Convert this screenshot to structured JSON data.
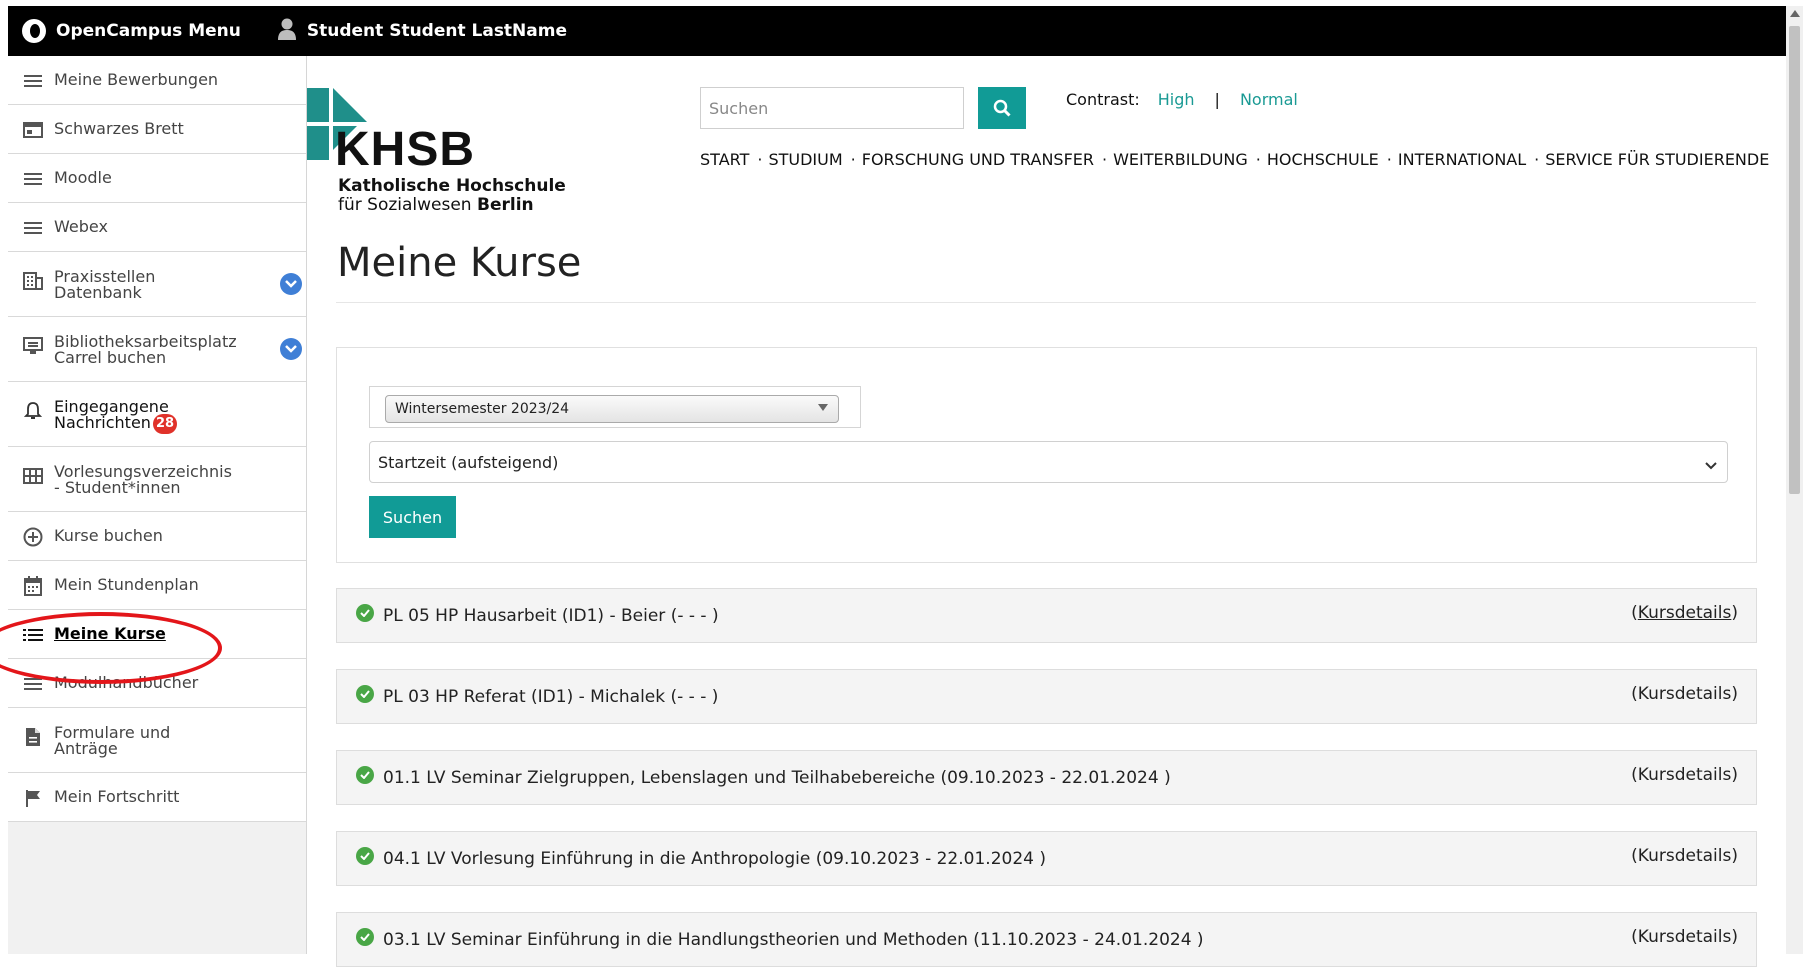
{
  "topbar": {
    "menu_label": "OpenCampus Menu",
    "user_name": "Student Student LastName"
  },
  "sidebar": {
    "items": [
      {
        "label": "Meine Bewerbungen",
        "icon": "hamburger-icon"
      },
      {
        "label": "Schwarzes Brett",
        "icon": "board-icon"
      },
      {
        "label": "Moodle",
        "icon": "hamburger-icon"
      },
      {
        "label": "Webex",
        "icon": "hamburger-icon"
      },
      {
        "label_1": "Praxisstellen",
        "label_2": "Datenbank",
        "icon": "building-icon",
        "has_dropdown": true
      },
      {
        "label_1": "Bibliotheksarbeitsplatz",
        "label_2": "Carrel buchen",
        "icon": "monitor-icon",
        "has_dropdown": true
      },
      {
        "label_1": "Eingegangene",
        "label_2": "Nachrichten",
        "icon": "bell-icon",
        "badge": "28"
      },
      {
        "label_1": "Vorlesungsverzeichnis",
        "label_2": "- Student*innen",
        "icon": "grid-icon"
      },
      {
        "label": "Kurse buchen",
        "icon": "plus-circle-icon"
      },
      {
        "label": "Mein Stundenplan",
        "icon": "calendar-icon"
      },
      {
        "label": "Meine Kurse",
        "icon": "list-icon",
        "active": true
      },
      {
        "label": "Modulhandbücher",
        "icon": "hamburger-icon"
      },
      {
        "label_1": "Formulare und",
        "label_2": "Anträge",
        "icon": "document-icon"
      },
      {
        "label": "Mein Fortschritt",
        "icon": "flag-icon"
      }
    ]
  },
  "header": {
    "logo_word": "KHSB",
    "logo_line1": "Katholische Hochschule",
    "logo_line2_a": "für Sozialwesen ",
    "logo_line2_b": "Berlin",
    "search_placeholder": "Suchen",
    "contrast_label": "Contrast:",
    "contrast_high": "High",
    "contrast_sep": "|",
    "contrast_normal": "Normal",
    "nav": [
      "START",
      "STUDIUM",
      "FORSCHUNG UND TRANSFER",
      "WEITERBILDUNG",
      "HOCHSCHULE",
      "INTERNATIONAL",
      "SERVICE FÜR STUDIERENDE"
    ],
    "nav_sep": "·"
  },
  "main": {
    "title": "Meine Kurse",
    "semester_value": "Wintersemester 2023/24",
    "sort_value": "Startzeit (aufsteigend)",
    "submit_label": "Suchen",
    "details_label": "(Kursdetails)",
    "details_open": "(",
    "details_word": "Kursdetails",
    "details_close": ")",
    "courses": [
      "PL 05 HP Hausarbeit (ID1) - Beier (- - - )",
      "PL 03 HP Referat (ID1) - Michalek (- - - )",
      "01.1 LV Seminar Zielgruppen, Lebenslagen und Teilhabebereiche (09.10.2023 - 22.01.2024 )",
      "04.1 LV Vorlesung Einführung in die Anthropologie (09.10.2023 - 22.01.2024 )",
      "03.1 LV Seminar Einführung in die Handlungstheorien und Methoden (11.10.2023 - 24.01.2024 )"
    ]
  },
  "colors": {
    "accent": "#119b96",
    "topbar": "#000000",
    "badge": "#e0322a",
    "dropdown": "#3f7fd6",
    "status_ok": "#49a646",
    "annotation_ring": "#e3161a"
  }
}
